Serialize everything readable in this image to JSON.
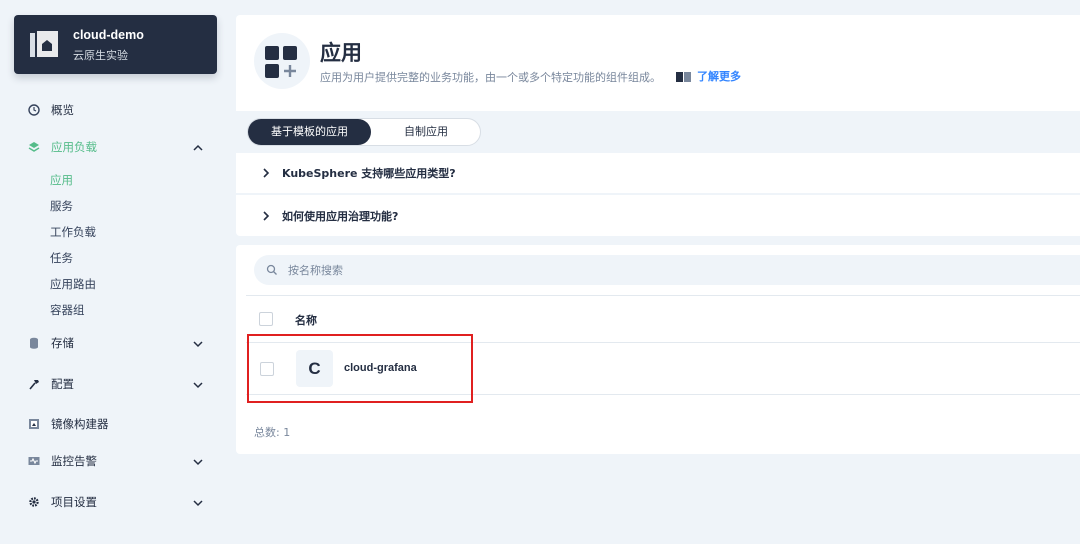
{
  "project": {
    "name": "cloud-demo",
    "subtitle": "云原生实验"
  },
  "sidebar": {
    "overview": "概览",
    "workloads": {
      "label": "应用负载",
      "items": [
        "应用",
        "服务",
        "工作负载",
        "任务",
        "应用路由",
        "容器组"
      ]
    },
    "storage": "存储",
    "config": "配置",
    "image_builder": "镜像构建器",
    "monitoring": "监控告警",
    "settings": "项目设置"
  },
  "header": {
    "title": "应用",
    "description": "应用为用户提供完整的业务功能，由一个或多个特定功能的组件组成。",
    "learn_more": "了解更多"
  },
  "tabs": {
    "template": "基于模板的应用",
    "custom": "自制应用"
  },
  "faq": [
    "KubeSphere 支持哪些应用类型?",
    "如何使用应用治理功能?"
  ],
  "search": {
    "placeholder": "按名称搜索"
  },
  "table": {
    "header_name": "名称",
    "rows": [
      {
        "initial": "C",
        "name": "cloud-grafana"
      }
    ],
    "total": "总数: 1"
  },
  "colors": {
    "accent": "#55bc8a",
    "dark": "#242e42",
    "highlight": "#e02020",
    "link": "#3385ff"
  }
}
